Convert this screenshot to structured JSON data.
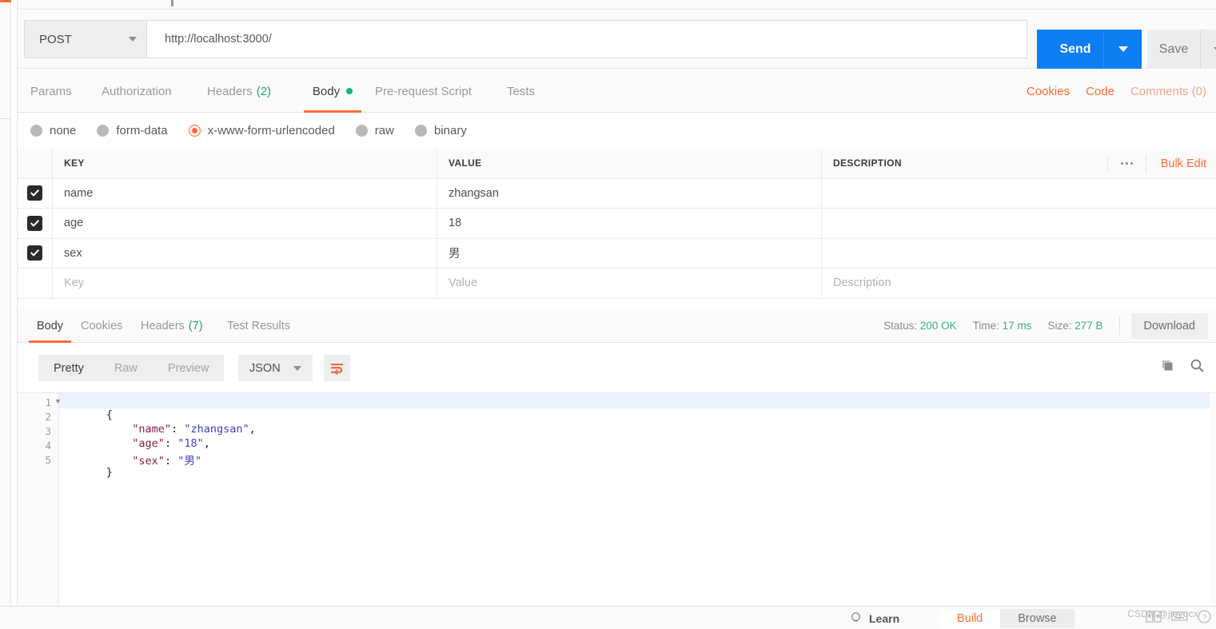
{
  "request": {
    "method": "POST",
    "url": "http://localhost:3000/",
    "send_label": "Send",
    "save_label": "Save",
    "tabs": [
      {
        "label": "Params",
        "active": false
      },
      {
        "label": "Authorization",
        "active": false
      },
      {
        "label": "Headers",
        "count": "(2)",
        "active": false
      },
      {
        "label": "Body",
        "active": true
      },
      {
        "label": "Pre-request Script",
        "active": false
      },
      {
        "label": "Tests",
        "active": false
      }
    ],
    "links": {
      "cookies": "Cookies",
      "code": "Code",
      "comments": "Comments (0)"
    },
    "body_types": [
      {
        "label": "none",
        "selected": false
      },
      {
        "label": "form-data",
        "selected": false
      },
      {
        "label": "x-www-form-urlencoded",
        "selected": true
      },
      {
        "label": "raw",
        "selected": false
      },
      {
        "label": "binary",
        "selected": false
      }
    ]
  },
  "kv_table": {
    "headers": {
      "key": "KEY",
      "value": "VALUE",
      "description": "DESCRIPTION"
    },
    "bulk_edit": "Bulk Edit",
    "rows": [
      {
        "checked": true,
        "key": "name",
        "value": "zhangsan",
        "description": ""
      },
      {
        "checked": true,
        "key": "age",
        "value": "18",
        "description": ""
      },
      {
        "checked": true,
        "key": "sex",
        "value": "男",
        "description": ""
      }
    ],
    "placeholder_row": {
      "key": "Key",
      "value": "Value",
      "description": "Description"
    }
  },
  "response": {
    "tabs": [
      {
        "label": "Body",
        "active": true
      },
      {
        "label": "Cookies",
        "active": false
      },
      {
        "label": "Headers",
        "count": "(7)",
        "active": false
      },
      {
        "label": "Test Results",
        "active": false
      }
    ],
    "status_label": "Status:",
    "status_value": "200 OK",
    "time_label": "Time:",
    "time_value": "17 ms",
    "size_label": "Size:",
    "size_value": "277 B",
    "download_label": "Download",
    "view_modes": [
      {
        "label": "Pretty",
        "active": true
      },
      {
        "label": "Raw",
        "active": false
      },
      {
        "label": "Preview",
        "active": false
      }
    ],
    "format": "JSON",
    "code_lines": [
      {
        "num": "1",
        "fold": true,
        "tokens": [
          {
            "t": "{",
            "c": "j-brace"
          }
        ]
      },
      {
        "num": "2",
        "fold": false,
        "tokens": [
          {
            "t": "    \"name\"",
            "c": "j-key"
          },
          {
            "t": ": ",
            "c": "j-punc"
          },
          {
            "t": "\"zhangsan\"",
            "c": "j-str"
          },
          {
            "t": ",",
            "c": "j-punc"
          }
        ]
      },
      {
        "num": "3",
        "fold": false,
        "tokens": [
          {
            "t": "    \"age\"",
            "c": "j-key"
          },
          {
            "t": ": ",
            "c": "j-punc"
          },
          {
            "t": "\"18\"",
            "c": "j-str"
          },
          {
            "t": ",",
            "c": "j-punc"
          }
        ]
      },
      {
        "num": "4",
        "fold": false,
        "tokens": [
          {
            "t": "    \"sex\"",
            "c": "j-key"
          },
          {
            "t": ": ",
            "c": "j-punc"
          },
          {
            "t": "\"男\"",
            "c": "j-str"
          }
        ]
      },
      {
        "num": "5",
        "fold": false,
        "tokens": [
          {
            "t": "}",
            "c": "j-brace"
          }
        ]
      }
    ]
  },
  "footer": {
    "learn_label": "Learn",
    "modes": [
      {
        "label": "Build",
        "active": true
      },
      {
        "label": "Browse",
        "active": false
      }
    ],
    "watermark": "CSDN @jieyucx"
  },
  "colors": {
    "accent_orange": "#ff6c37",
    "send_blue": "#0d7ff2",
    "status_green": "#3bb273",
    "header_count_green": "#22a06b"
  }
}
